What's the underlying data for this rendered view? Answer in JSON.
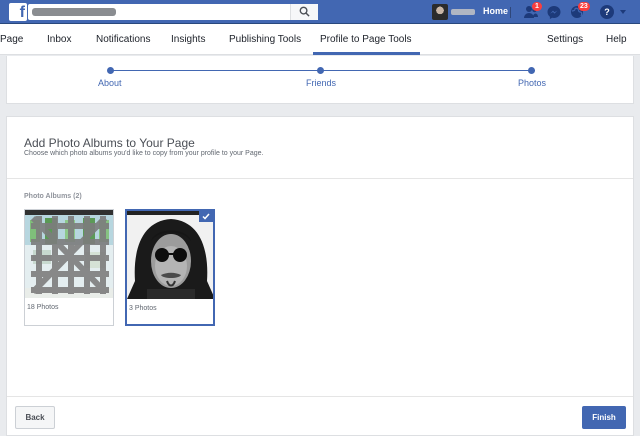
{
  "topbar": {
    "logo_letter": "f",
    "search": {
      "placeholder": ""
    },
    "home_label": "Home",
    "friend_requests_count": "1",
    "notifications_count": "23",
    "help_glyph": "?",
    "icons": [
      "search-icon",
      "friend-requests-icon",
      "messenger-icon",
      "notifications-globe-icon",
      "help-icon",
      "chevron-down-icon"
    ],
    "accent_color": "#4267b2"
  },
  "pagenav": {
    "items": [
      {
        "label": "Page"
      },
      {
        "label": "Inbox"
      },
      {
        "label": "Notifications"
      },
      {
        "label": "Insights"
      },
      {
        "label": "Publishing Tools"
      },
      {
        "label": "Profile to Page Tools"
      }
    ],
    "active": "Profile to Page Tools",
    "settings_label": "Settings",
    "help_label": "Help"
  },
  "stepper": {
    "steps": [
      {
        "label": "About"
      },
      {
        "label": "Friends"
      },
      {
        "label": "Photos"
      }
    ]
  },
  "main": {
    "title": "Add Photo Albums to Your Page",
    "subtitle": "Choose which photo albums you'd like to copy from your profile to your Page.",
    "albums_heading": "Photo Albums (2)",
    "albums": [
      {
        "count_label": "18 Photos",
        "selected": false
      },
      {
        "count_label": "3 Photos",
        "selected": true
      }
    ]
  },
  "footer": {
    "back_label": "Back",
    "finish_label": "Finish"
  }
}
